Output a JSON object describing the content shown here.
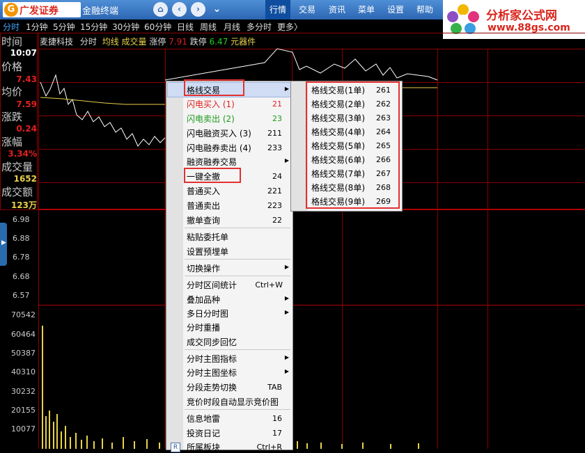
{
  "header": {
    "brand_mark": "G",
    "brand_name": "广发证券",
    "brand_sub": "金融终端",
    "menu": [
      "行情",
      "交易",
      "资讯",
      "菜单",
      "设置",
      "帮助"
    ],
    "active_menu": "行情"
  },
  "ad": {
    "title": "分析家公式网",
    "url": "www.88gs.com"
  },
  "periods": [
    "分时",
    "1分钟",
    "5分钟",
    "15分钟",
    "30分钟",
    "60分钟",
    "日线",
    "周线",
    "月线",
    "多分时",
    "更多〉"
  ],
  "stock": {
    "name": "麦捷科技",
    "view": "分时",
    "avg_line": "均线",
    "volume": "成交量",
    "limit_up_label": "涨停",
    "limit_up": "7.91",
    "limit_down_label": "跌停",
    "limit_down": "6.47",
    "component": "元器件"
  },
  "info": {
    "time_label": "时间",
    "time": "10:07",
    "price_label": "价格",
    "price": "7.43",
    "avg_label": "均价",
    "avg": "7.59",
    "change_label": "涨跌",
    "change": "0.24",
    "pct_label": "涨幅",
    "pct": "3.34%",
    "vol_label": "成交量",
    "vol": "1652",
    "amt_label": "成交额",
    "amt": "123万"
  },
  "price_axis": [
    "6.98",
    "6.88",
    "6.78",
    "6.68",
    "6.57"
  ],
  "volume_axis": [
    "70542",
    "60464",
    "50387",
    "40310",
    "30232",
    "20155",
    "10077"
  ],
  "context_menu": [
    {
      "label": "格线交易",
      "shortcut": "",
      "submenu": true,
      "color": "#000"
    },
    {
      "label": "闪电买入 (1)",
      "shortcut": "21",
      "color": "#e02020"
    },
    {
      "label": "闪电卖出 (2)",
      "shortcut": "23",
      "color": "#1a9a1a"
    },
    {
      "label": "闪电融资买入 (3)",
      "shortcut": "211",
      "color": "#000"
    },
    {
      "label": "闪电融券卖出 (4)",
      "shortcut": "233",
      "color": "#000"
    },
    {
      "label": "融资融券交易",
      "shortcut": "",
      "submenu": true,
      "color": "#000"
    },
    {
      "label": "一键全撤",
      "shortcut": "24",
      "color": "#000"
    },
    {
      "label": "普通买入",
      "shortcut": "221",
      "color": "#000"
    },
    {
      "label": "普通卖出",
      "shortcut": "223",
      "color": "#000"
    },
    {
      "label": "撤单查询",
      "shortcut": "22",
      "color": "#000"
    },
    {
      "label": "粘贴委托单",
      "shortcut": "",
      "color": "#000"
    },
    {
      "label": "设置预埋单",
      "shortcut": "",
      "color": "#000"
    },
    {
      "label": "切换操作",
      "shortcut": "",
      "submenu": true,
      "color": "#000"
    },
    {
      "label": "分时区间统计",
      "shortcut": "Ctrl+W",
      "color": "#000"
    },
    {
      "label": "叠加品种",
      "shortcut": "",
      "submenu": true,
      "color": "#000"
    },
    {
      "label": "多日分时图",
      "shortcut": "",
      "submenu": true,
      "color": "#000"
    },
    {
      "label": "分时重播",
      "shortcut": "",
      "color": "#000"
    },
    {
      "label": "成交同步回忆",
      "shortcut": "",
      "color": "#000"
    },
    {
      "label": "分时主图指标",
      "shortcut": "",
      "submenu": true,
      "color": "#000"
    },
    {
      "label": "分时主图坐标",
      "shortcut": "",
      "submenu": true,
      "color": "#000"
    },
    {
      "label": "分段走势切换",
      "shortcut": "TAB",
      "color": "#000"
    },
    {
      "label": "竞价时段自动显示竞价图",
      "shortcut": "",
      "color": "#000"
    },
    {
      "label": "信息地雷",
      "shortcut": "16",
      "color": "#000"
    },
    {
      "label": "投资日记",
      "shortcut": "17",
      "color": "#000"
    },
    {
      "label": "所属板块",
      "shortcut": "Ctrl+R",
      "icon": "R",
      "color": "#000"
    }
  ],
  "submenu": [
    {
      "label": "格线交易(1单)",
      "shortcut": "261"
    },
    {
      "label": "格线交易(2单)",
      "shortcut": "262"
    },
    {
      "label": "格线交易(3单)",
      "shortcut": "263"
    },
    {
      "label": "格线交易(4单)",
      "shortcut": "264"
    },
    {
      "label": "格线交易(5单)",
      "shortcut": "265"
    },
    {
      "label": "格线交易(6单)",
      "shortcut": "266"
    },
    {
      "label": "格线交易(7单)",
      "shortcut": "267"
    },
    {
      "label": "格线交易(8单)",
      "shortcut": "268"
    },
    {
      "label": "格线交易(9单)",
      "shortcut": "269"
    }
  ],
  "colors": {
    "up": "#e02020",
    "avg": "#e8d24a",
    "grid": "#8b0000",
    "price_line": "#ffffff",
    "annotation": "#e23030"
  }
}
